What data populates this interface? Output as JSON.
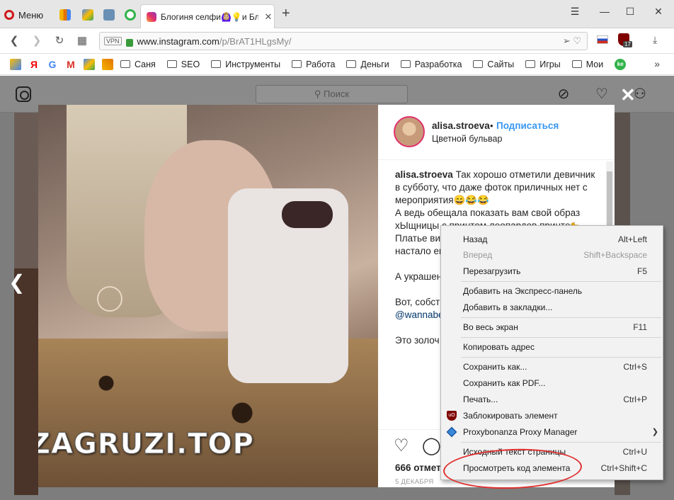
{
  "browser": {
    "menu_label": "Меню",
    "active_tab_title": "Блогиня селфи🙆🏼‍♀️💡и Бло",
    "tab_close": "✕",
    "new_tab": "+",
    "url_domain": "www.instagram.com",
    "url_path": "/p/BrAT1HLgsMy/",
    "vpn_label": "VPN",
    "ublock_count": "17",
    "window_controls": [
      "—",
      "☐",
      "✕"
    ]
  },
  "bookmarks": {
    "icons": [
      "Я",
      "G",
      "M"
    ],
    "folders": [
      "Саня",
      "SEO",
      "Инструменты",
      "Работа",
      "Деньги",
      "Разработка",
      "Сайты",
      "Игры",
      "Мои"
    ],
    "more": "»"
  },
  "instagram": {
    "search_placeholder": "Поиск",
    "post": {
      "username": "alisa.stroeva",
      "dot": "•",
      "follow_label": "Подписаться",
      "location": "Цветной бульвар",
      "caption_user": "alisa.stroeva",
      "caption_lines": [
        "Так хорошо отметили девичник в субботу, что даже фоток приличных нет с мероприятия😄😂😂",
        "А ведь обещала показать вам свой образ хЫщницы с принтом леопардов принте🐆",
        "Платье ви",
        "настало ег"
      ],
      "para2": "А украшен именно в",
      "para3": "Вот, собст с вами в с",
      "mention": "@wannabe",
      "para4": "Это золоч серьги, с р А ещё я по новой кол",
      "likes": "666 отмет",
      "date": "5 ДЕКАБРЯ"
    }
  },
  "watermark": "ZAGRUZI.TOP",
  "context_menu": {
    "items": [
      {
        "label": "Назад",
        "shortcut": "Alt+Left",
        "disabled": false
      },
      {
        "label": "Вперед",
        "shortcut": "Shift+Backspace",
        "disabled": true
      },
      {
        "label": "Перезагрузить",
        "shortcut": "F5",
        "disabled": false
      },
      {
        "label": "Добавить на Экспресс-панель",
        "shortcut": "",
        "disabled": false
      },
      {
        "label": "Добавить в закладки...",
        "shortcut": "",
        "disabled": false
      },
      {
        "label": "Во весь экран",
        "shortcut": "F11",
        "disabled": false
      },
      {
        "label": "Копировать адрес",
        "shortcut": "",
        "disabled": false
      },
      {
        "label": "Сохранить как...",
        "shortcut": "Ctrl+S",
        "disabled": false
      },
      {
        "label": "Сохранить как PDF...",
        "shortcut": "",
        "disabled": false
      },
      {
        "label": "Печать...",
        "shortcut": "Ctrl+P",
        "disabled": false
      },
      {
        "label": "Заблокировать элемент",
        "shortcut": "",
        "disabled": false
      },
      {
        "label": "Proxybonanza Proxy Manager",
        "shortcut": "",
        "disabled": false
      },
      {
        "label": "Исходный текст страницы",
        "shortcut": "Ctrl+U",
        "disabled": false
      },
      {
        "label": "Просмотреть код элемента",
        "shortcut": "Ctrl+Shift+C",
        "disabled": false
      }
    ],
    "ublock_icon_text": "uO"
  }
}
